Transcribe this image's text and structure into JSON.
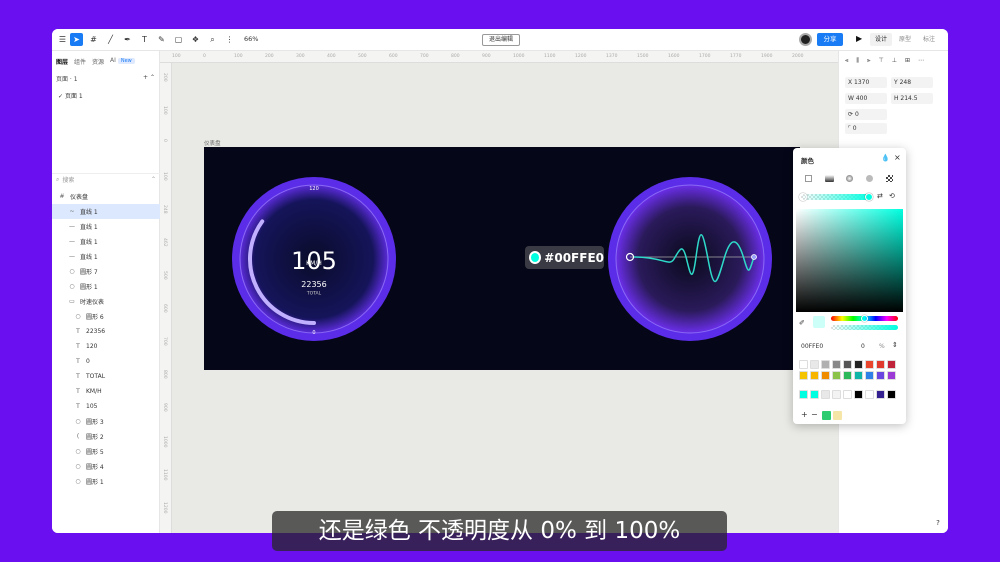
{
  "app": {
    "zoom": "66%",
    "exit_edit": "退出编辑",
    "share": "分享",
    "modes": [
      "设计",
      "原型",
      "标注"
    ]
  },
  "left": {
    "tabs": [
      "图层",
      "组件",
      "资源",
      "AI"
    ],
    "ai_badge": "New",
    "pages_label": "页面 · 1",
    "page_item": "页面 1",
    "search_placeholder": "搜索",
    "layers": [
      {
        "label": "仪表盘",
        "icon": "#",
        "sel": false
      },
      {
        "label": "直线 1",
        "icon": "~",
        "sel": true
      },
      {
        "label": "直线 1",
        "icon": "—",
        "sel": false
      },
      {
        "label": "直线 1",
        "icon": "—",
        "sel": false
      },
      {
        "label": "直线 1",
        "icon": "—",
        "sel": false
      },
      {
        "label": "圆形 7",
        "icon": "○",
        "sel": false
      },
      {
        "label": "圆形 1",
        "icon": "○",
        "sel": false
      },
      {
        "label": "时速仪表",
        "icon": "▭",
        "sel": false
      },
      {
        "label": "圆形 6",
        "icon": "○",
        "sel": false
      },
      {
        "label": "22356",
        "icon": "T",
        "sel": false
      },
      {
        "label": "120",
        "icon": "T",
        "sel": false
      },
      {
        "label": "0",
        "icon": "T",
        "sel": false
      },
      {
        "label": "TOTAL",
        "icon": "T",
        "sel": false
      },
      {
        "label": "KM/H",
        "icon": "T",
        "sel": false
      },
      {
        "label": "105",
        "icon": "T",
        "sel": false
      },
      {
        "label": "圆形 3",
        "icon": "○",
        "sel": false
      },
      {
        "label": "圆形 2",
        "icon": "(",
        "sel": false
      },
      {
        "label": "圆形 5",
        "icon": "○",
        "sel": false
      },
      {
        "label": "圆形 4",
        "icon": "○",
        "sel": false
      },
      {
        "label": "圆形 1",
        "icon": "○",
        "sel": false
      }
    ]
  },
  "canvas": {
    "frame_label": "仪表盘",
    "ruler_h": [
      "100",
      "0",
      "100",
      "200",
      "300",
      "400",
      "500",
      "600",
      "700",
      "800",
      "900",
      "1000",
      "1100",
      "1200",
      "1370",
      "1500",
      "1600",
      "1700",
      "1770",
      "1900",
      "2000"
    ],
    "ruler_v": [
      "200",
      "100",
      "0",
      "100",
      "248",
      "462",
      "500",
      "600",
      "700",
      "800",
      "900",
      "1000",
      "1100",
      "1200"
    ]
  },
  "gauge": {
    "speed": "105",
    "unit": "KM/H",
    "max": "120",
    "min": "0",
    "total": "22356",
    "total_label": "TOTAL",
    "progress": 0.35
  },
  "right": {
    "x": "1370",
    "y": "248",
    "w": "400",
    "h": "214.5",
    "rot": "0",
    "radius": "0"
  },
  "picker": {
    "title": "颜色",
    "hex": "00FFE0",
    "opacity": "0",
    "pct": "%",
    "swatches_row1": [
      "#ffffff",
      "#e8e8e8",
      "#b0b0b0",
      "#888888",
      "#555555",
      "#222222",
      "#e8452c",
      "#e0392e",
      "#c0243a"
    ],
    "swatches_row2": [
      "#f5c400",
      "#f7b500",
      "#f08c00",
      "#8bc34a",
      "#2eb85c",
      "#10b5a8",
      "#2e7fe6",
      "#6a45e0",
      "#9c3ad6"
    ],
    "swatches_row3": [
      "#00ffe0",
      "#00ffe0",
      "#e8e8e8",
      "#f3f3f3",
      "#ffffff",
      "#000000",
      "#ffffff",
      "#35208f",
      "#000000"
    ],
    "recent": [
      "#2ecc71",
      "#f5e6a8"
    ]
  },
  "hexchip": "#00FFE0",
  "subtitle": "还是绿色 不透明度从 0% 到 100%"
}
